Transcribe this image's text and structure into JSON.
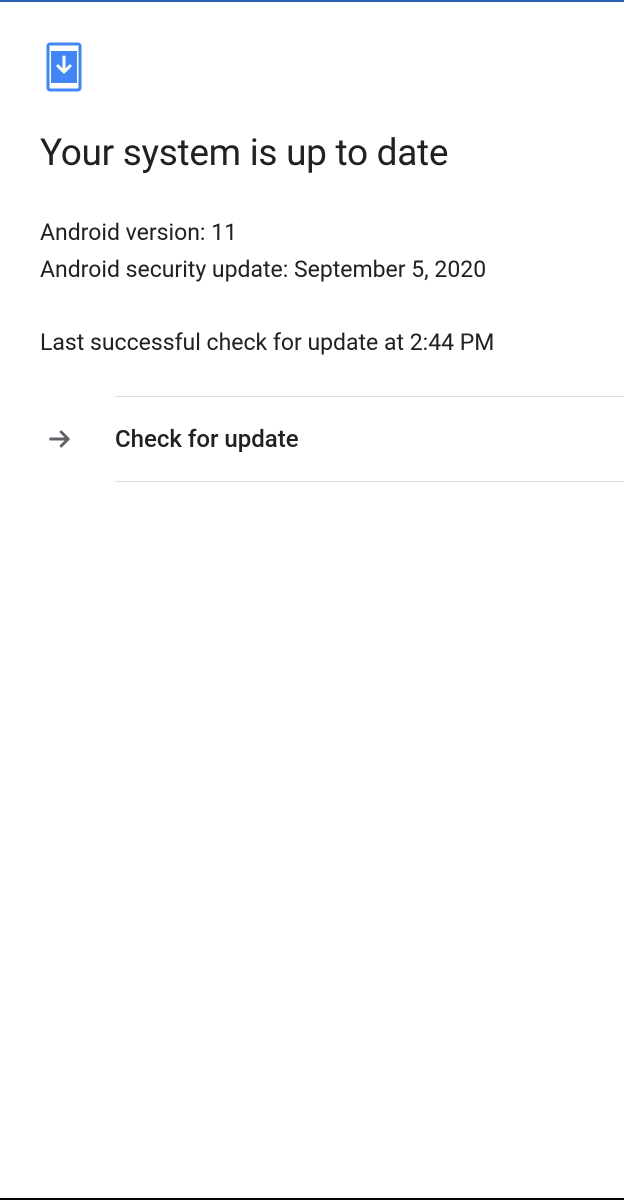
{
  "heading": "Your system is up to date",
  "version_line": "Android version: 11",
  "security_line": "Android security update: September 5, 2020",
  "last_check": "Last successful check for update at 2:44 PM",
  "action": {
    "label": "Check for update"
  }
}
